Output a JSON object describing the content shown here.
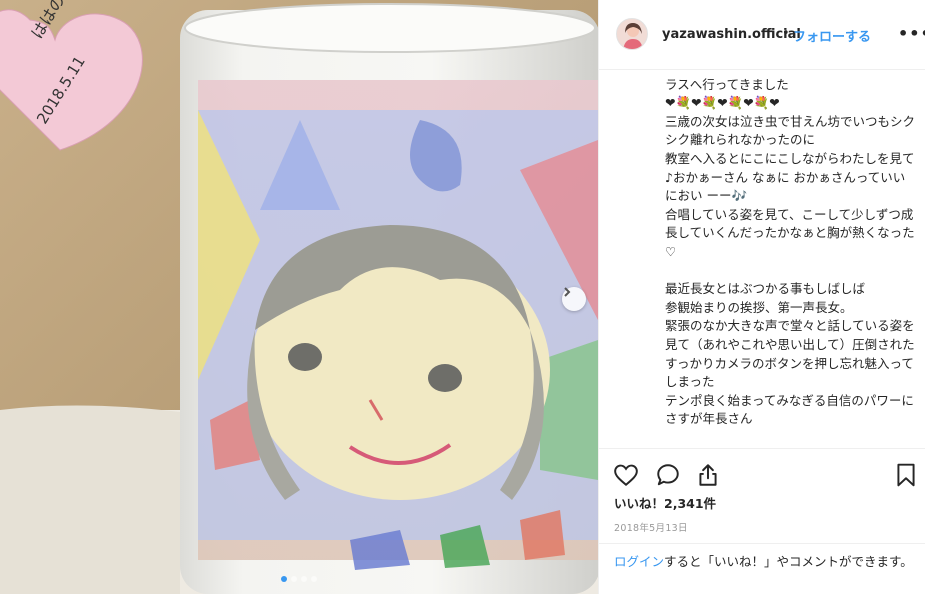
{
  "post": {
    "photo": {
      "note_text_line1": "ははのひによせて",
      "note_date": "2018.5.11",
      "current_slide": 1,
      "slide_count": 4
    },
    "header": {
      "username": "yazawashin.official",
      "separator": "•",
      "follow_label": "フォローする",
      "more_label": "•••"
    },
    "caption": {
      "lines": [
        "",
        "ラスへ行ってきました",
        "❤💐❤💐❤💐❤💐❤",
        "三歳の次女は泣き虫で甘えん坊でいつもシクシク離れられなかったのに",
        "教室へ入るとにこにこしながらわたしを見て",
        "♪おかぁーさん なぁに おかぁさんっていいにおい ーー🎶",
        "合唱している姿を見て、こーして少しずつ成長していくんだったかなぁと胸が熱くなった♡",
        "",
        "最近長女とはぶつかる事もしばしば",
        "参観始まりの挨拶、第一声長女。",
        "緊張のなか大きな声で堂々と話している姿を見て（あれやこれや思い出して）圧倒された",
        "すっかりカメラのボタンを押し忘れ魅入ってしまった",
        "テンポ良く始まってみなぎる自信のパワーにさすが年長さん"
      ]
    },
    "actions": {
      "like_icon": "heart-outline-icon",
      "comment_icon": "comment-bubble-icon",
      "share_icon": "share-upload-icon",
      "save_icon": "bookmark-icon"
    },
    "likes_label": "いいね！2,341件",
    "date_label": "2018年5月13日",
    "login_prompt": {
      "link": "ログイン",
      "rest": "すると「いいね！」やコメントができます。"
    },
    "colors": {
      "accent": "#3897f0",
      "text": "#262626",
      "muted": "#999999",
      "border": "#efefef"
    }
  }
}
